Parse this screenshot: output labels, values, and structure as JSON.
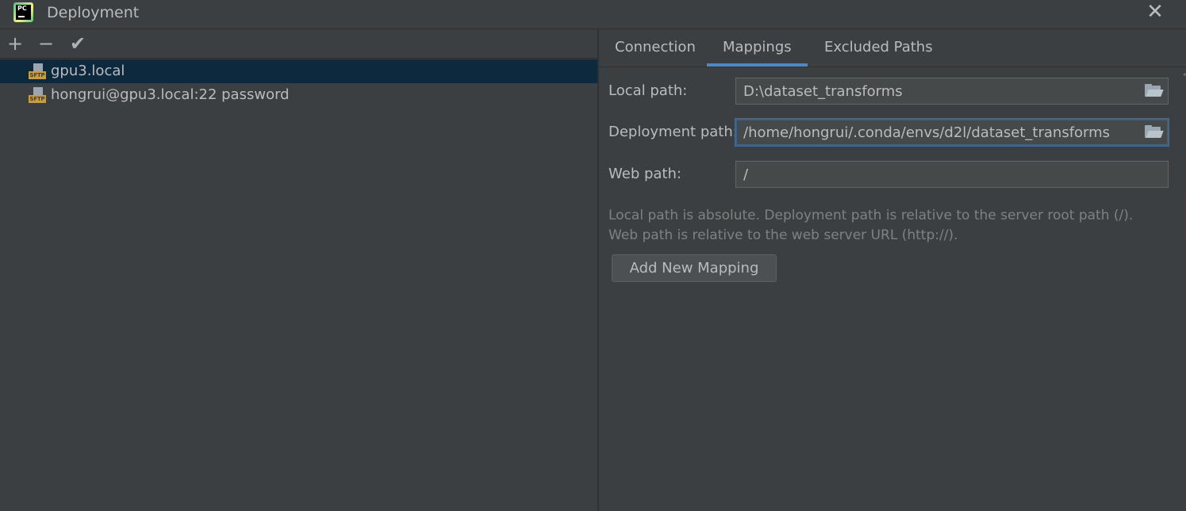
{
  "window": {
    "title": "Deployment",
    "close_label": "✕",
    "logo_text": "PC"
  },
  "toolbar": {
    "add_label": "+",
    "remove_label": "−",
    "apply_label": "✔"
  },
  "servers": [
    {
      "label": "gpu3.local",
      "icon": "sftp-icon",
      "icon_text": "SFTP",
      "selected": true
    },
    {
      "label": "hongrui@gpu3.local:22 password",
      "icon": "sftp-icon",
      "icon_text": "SFTP",
      "selected": false
    }
  ],
  "tabs": [
    {
      "label": "Connection",
      "active": false
    },
    {
      "label": "Mappings",
      "active": true
    },
    {
      "label": "Excluded Paths",
      "active": false
    }
  ],
  "mappings": {
    "local_path_label": "Local path:",
    "local_path_value": "D:\\dataset_transforms",
    "deployment_path_label": "Deployment path:",
    "deployment_path_value": "/home/hongrui/.conda/envs/d2l/dataset_transforms",
    "web_path_label": "Web path:",
    "web_path_value": "/",
    "hint_line1": "Local path is absolute. Deployment path is relative to the server root path (/).",
    "hint_line2": "Web path is relative to the web server URL (http://).",
    "add_mapping_label": "Add New Mapping"
  },
  "colors": {
    "background": "#3c3f41",
    "selection": "#0d293e",
    "accent": "#4a88c7",
    "text": "#bbbbbb",
    "hint_text": "#808080"
  }
}
